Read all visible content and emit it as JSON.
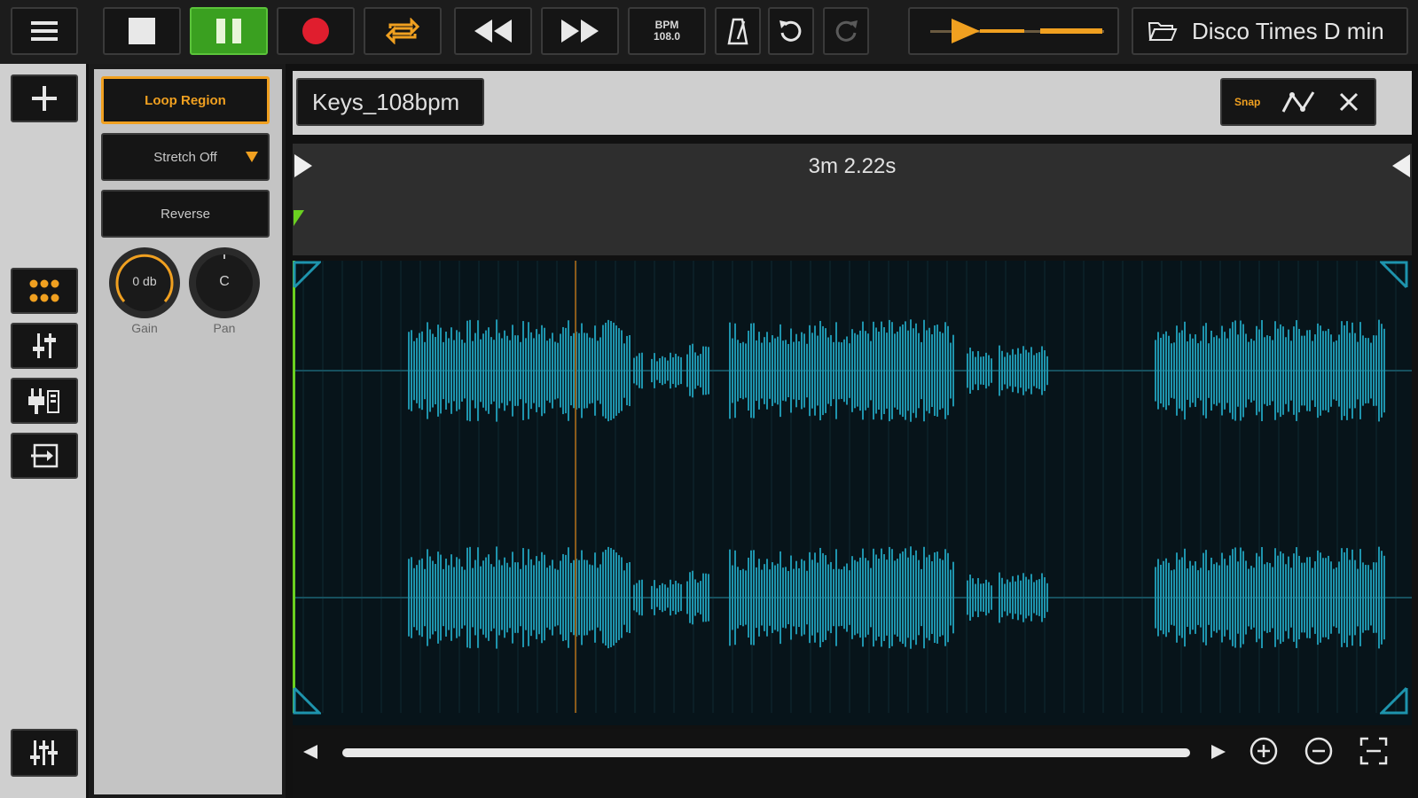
{
  "transport": {
    "bpm_label": "BPM",
    "bpm_value": "108.0"
  },
  "session": {
    "name": "Disco Times D min"
  },
  "clip": {
    "name": "Keys_108bpm",
    "duration": "3m 2.22s",
    "snap_label": "Snap"
  },
  "panel": {
    "loop_region_label": "Loop Region",
    "stretch_label": "Stretch Off",
    "reverse_label": "Reverse",
    "gain_value": "0 db",
    "gain_label": "Gain",
    "pan_value": "C",
    "pan_label": "Pan"
  },
  "colors": {
    "accent_orange": "#f0a020",
    "pause_green": "#3aa020",
    "record_red": "#e01e2e",
    "waveform": "#1e94ad",
    "start_marker": "#6ad020"
  },
  "icons": {
    "menu": "hamburger-icon",
    "stop": "stop-icon",
    "pause": "pause-icon",
    "record": "record-icon",
    "loop": "loop-icon",
    "rewind": "rewind-icon",
    "fast_forward": "fast-forward-icon",
    "metronome": "metronome-icon",
    "undo": "undo-icon",
    "redo": "redo-icon",
    "folder": "folder-icon"
  }
}
